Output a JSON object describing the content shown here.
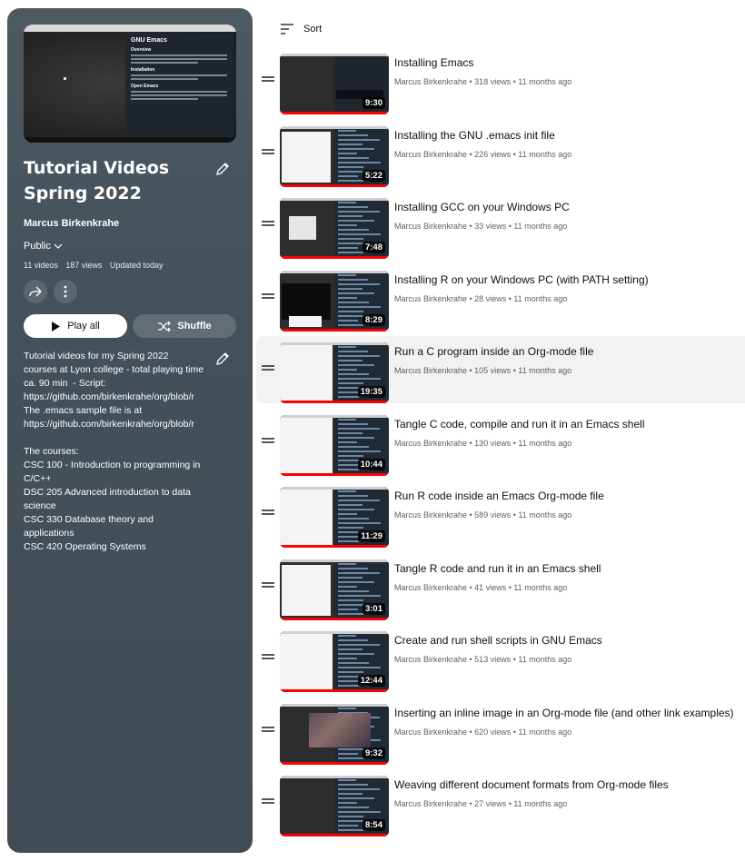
{
  "playlist": {
    "title_line1": "Tutorial Videos",
    "title_line2": "Spring 2022",
    "owner": "Marcus Birkenkrahe",
    "privacy": "Public",
    "video_count": "11 videos",
    "view_count": "187 views",
    "updated": "Updated today",
    "play_all_label": "Play all",
    "shuffle_label": "Shuffle",
    "description": "Tutorial videos for my Spring 2022\ncourses at Lyon college - total playing time\nca. 90 min  - Script:\nhttps://github.com/birkenkrahe/org/blob/r\nThe .emacs sample file is at\nhttps://github.com/birkenkrahe/org/blob/r\n\nThe courses:\nCSC 100 - Introduction to programming in\nC/C++\nDSC 205 Advanced introduction to data\nscience\nCSC 330 Database theory and\napplications\nCSC 420 Operating Systems",
    "hero_doc_title": "GNU Emacs",
    "hero_doc_sections": [
      "Overview",
      "Installation",
      "Open Emacs"
    ]
  },
  "list": {
    "sort_label": "Sort",
    "videos": [
      {
        "title": "Installing Emacs",
        "meta": "Marcus Birkenkrahe • 318 views • 11 months ago",
        "duration": "9:30",
        "style": "doc"
      },
      {
        "title": "Installing the GNU .emacs init file",
        "meta": "Marcus Birkenkrahe • 226 views • 11 months ago",
        "duration": "5:22",
        "style": "files"
      },
      {
        "title": "Installing GCC on your Windows PC",
        "meta": "Marcus Birkenkrahe • 33 views • 11 months ago",
        "duration": "7:48",
        "style": "dialog"
      },
      {
        "title": "Installing R on your Windows PC (with PATH setting)",
        "meta": "Marcus Birkenkrahe • 28 views • 11 months ago",
        "duration": "8:29",
        "style": "terminal"
      },
      {
        "title": "Run a C program inside an Org-mode file",
        "meta": "Marcus Birkenkrahe • 105 views • 11 months ago",
        "duration": "19:35",
        "style": "light"
      },
      {
        "title": "Tangle C code, compile and run it in an Emacs shell",
        "meta": "Marcus Birkenkrahe • 130 views • 11 months ago",
        "duration": "10:44",
        "style": "light"
      },
      {
        "title": "Run R code inside an Emacs Org-mode file",
        "meta": "Marcus Birkenkrahe • 589 views • 11 months ago",
        "duration": "11:29",
        "style": "light"
      },
      {
        "title": "Tangle R code and run it in an Emacs shell",
        "meta": "Marcus Birkenkrahe • 41 views • 11 months ago",
        "duration": "3:01",
        "style": "files"
      },
      {
        "title": "Create and run shell scripts in GNU Emacs",
        "meta": "Marcus Birkenkrahe • 513 views • 11 months ago",
        "duration": "12:44",
        "style": "light"
      },
      {
        "title": "Inserting an inline image in an Org-mode file (and other link examples)",
        "meta": "Marcus Birkenkrahe • 620 views • 11 months ago",
        "duration": "9:32",
        "style": "image"
      },
      {
        "title": "Weaving different document formats from Org-mode files",
        "meta": "Marcus Birkenkrahe • 27 views • 11 months ago",
        "duration": "8:54",
        "style": "dark"
      }
    ]
  },
  "colors": {
    "panel_bg": "#45515a",
    "progress_red": "#ff0000",
    "active_row": "#f2f2f2"
  }
}
